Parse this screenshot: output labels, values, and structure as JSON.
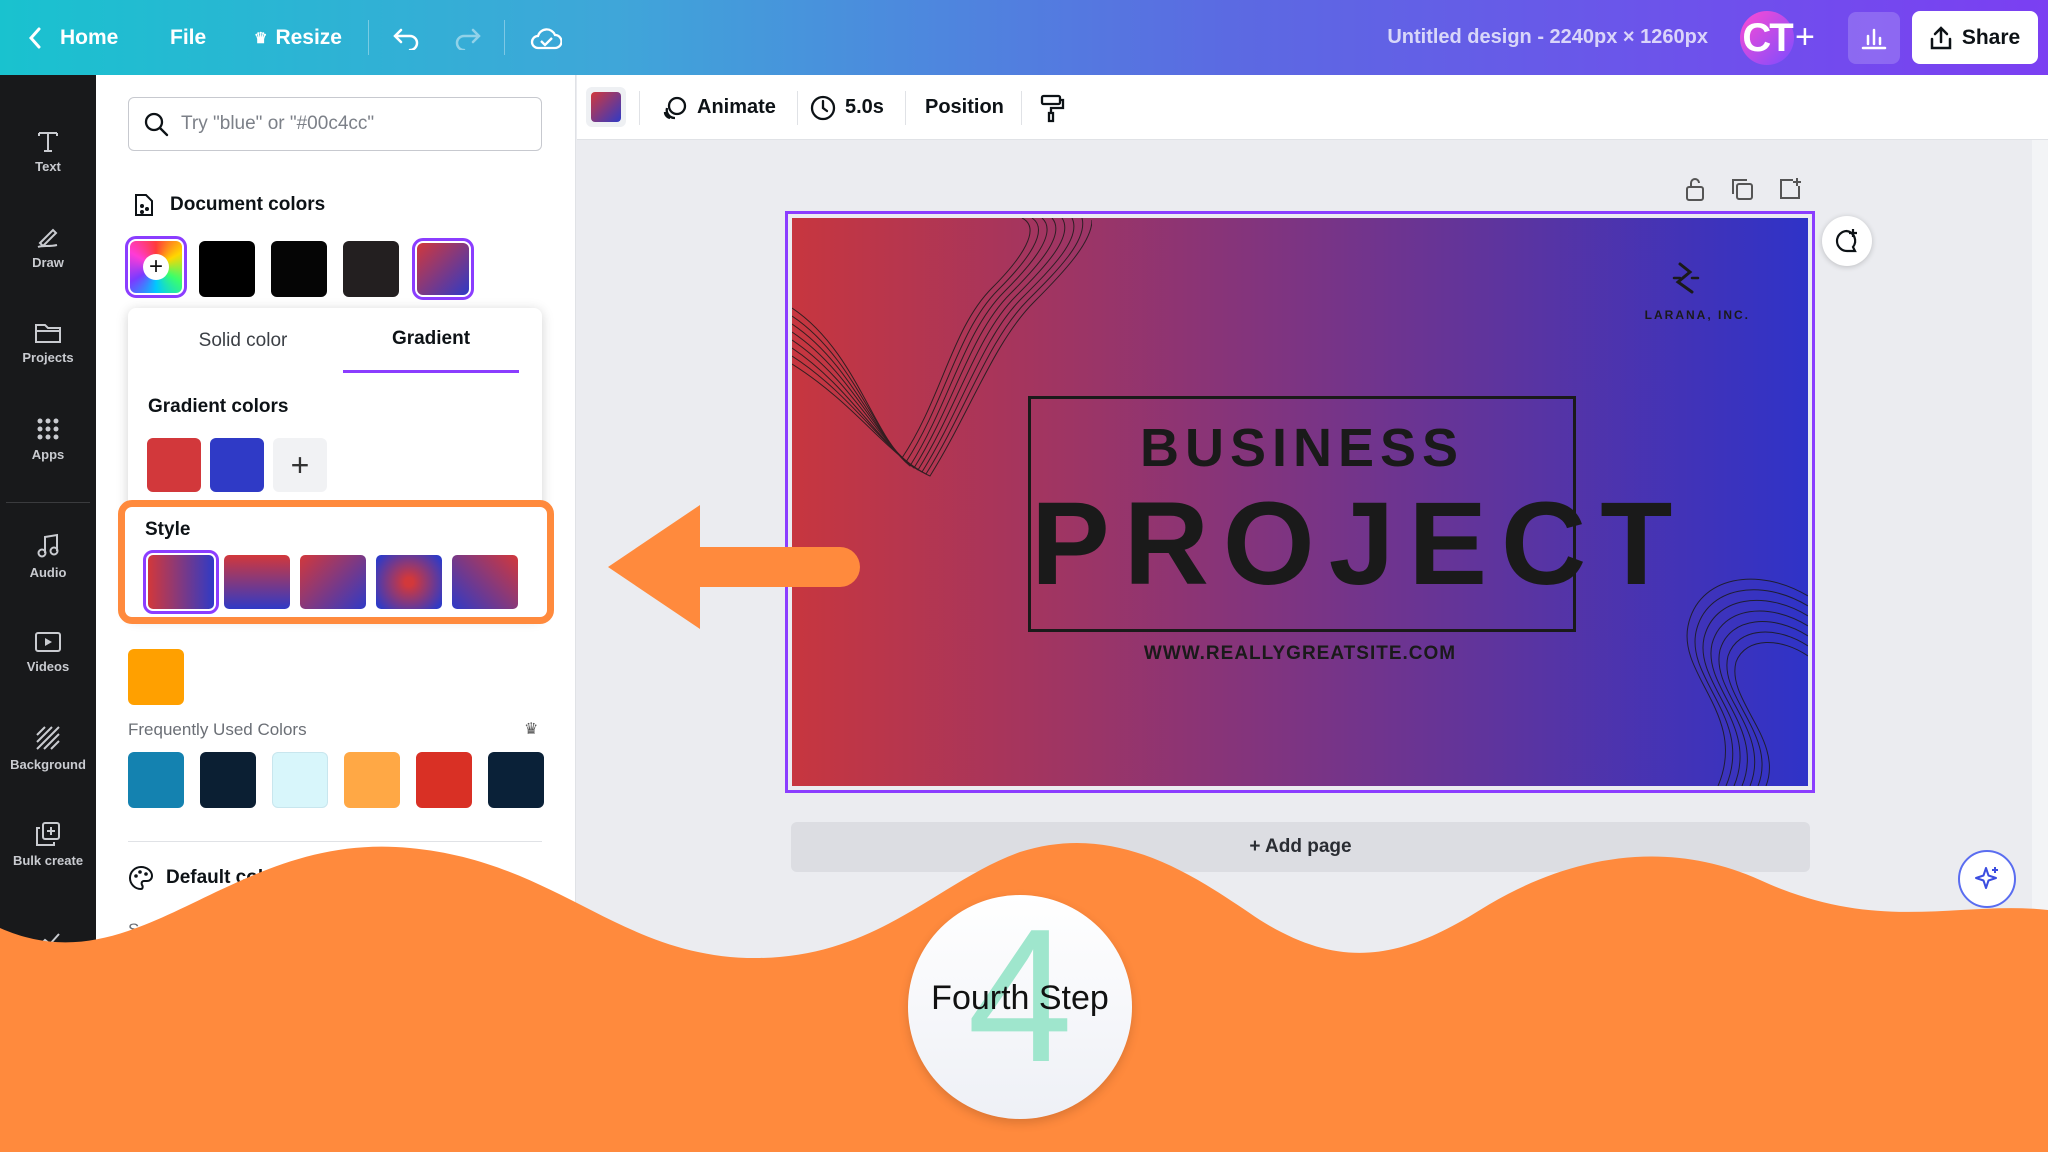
{
  "topbar": {
    "home_label": "Home",
    "file_label": "File",
    "resize_label": "Resize",
    "doc_title": "Untitled design - 2240px × 1260px",
    "avatar_initials": "CT",
    "share_label": "Share"
  },
  "rail": {
    "items": [
      {
        "label": "Text",
        "icon": "text-icon"
      },
      {
        "label": "Draw",
        "icon": "draw-icon"
      },
      {
        "label": "Projects",
        "icon": "folder-icon"
      },
      {
        "label": "Apps",
        "icon": "apps-grid-icon"
      },
      {
        "label": "Audio",
        "icon": "music-note-icon"
      },
      {
        "label": "Videos",
        "icon": "video-icon"
      },
      {
        "label": "Background",
        "icon": "background-icon"
      },
      {
        "label": "Bulk create",
        "icon": "bulk-create-icon"
      }
    ]
  },
  "panel": {
    "search_placeholder": "Try \"blue\" or \"#00c4cc\"",
    "document_colors_title": "Document colors",
    "document_colors": [
      "#000000",
      "#050505",
      "#231f20"
    ],
    "tabs": {
      "solid": "Solid color",
      "gradient": "Gradient"
    },
    "gradient_colors_title": "Gradient colors",
    "gradient_colors": [
      "#d2383b",
      "#2f3ac6"
    ],
    "style_title": "Style",
    "photo_colors_color": "#ffa000",
    "frequent_title": "Frequently Used Colors",
    "frequent_colors": [
      "#1482b0",
      "#0b1f33",
      "#d8f6fb",
      "#ffa845",
      "#d93025",
      "#0a2138"
    ],
    "default_colors_title": "Default colors",
    "solid_colors_label": "Solid colors"
  },
  "editor": {
    "animate_label": "Animate",
    "duration_label": "5.0s",
    "position_label": "Position",
    "add_page_label": "+ Add page"
  },
  "design": {
    "logo_text": "LARANA, INC.",
    "heading_small": "BUSINESS",
    "heading_large": "PROJECT",
    "url": "WWW.REALLYGREATSITE.COM",
    "gradient_start": "#c7363f",
    "gradient_end": "#2f33c8"
  },
  "overlay": {
    "step_number": "4",
    "step_text": "Fourth Step",
    "accent_color": "#ff8a3d"
  }
}
